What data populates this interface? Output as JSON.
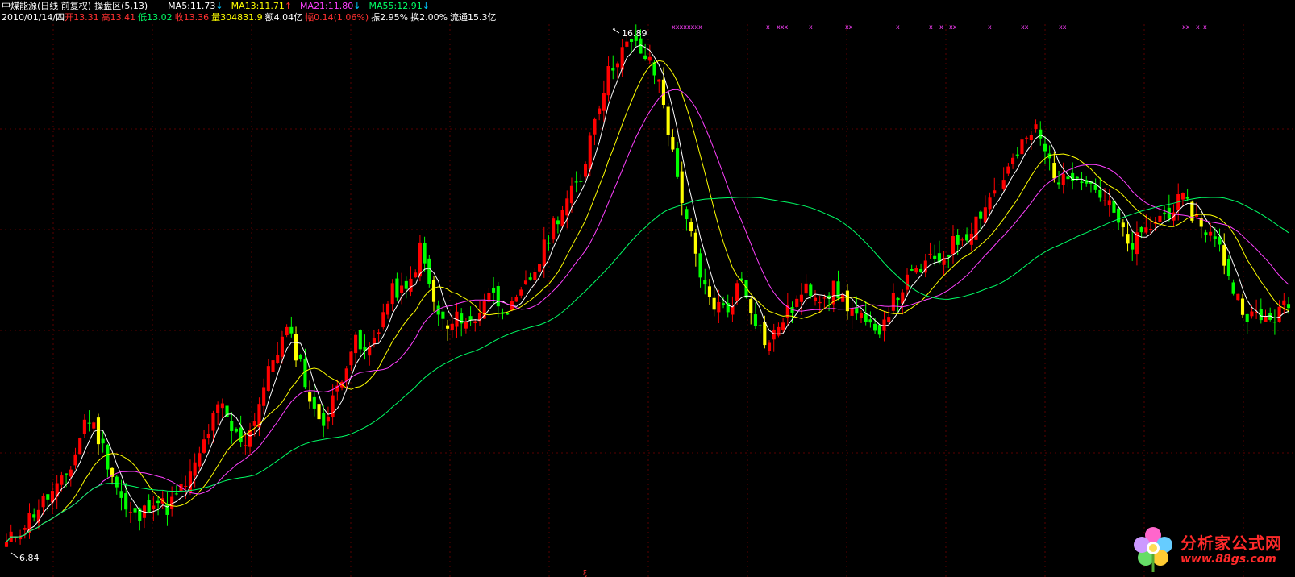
{
  "header": {
    "stock_title": "中煤能源(日线 前复权)",
    "panel_name": "操盘区",
    "params": "(5,13)",
    "ma_items": [
      {
        "label": "MA5:11.73",
        "arrow": "↓",
        "color": "#ffffff",
        "arrow_color": "#00c8ff"
      },
      {
        "label": "MA13:11.71",
        "arrow": "↑",
        "color": "#ffff00",
        "arrow_color": "#ff3030"
      },
      {
        "label": "MA21:11.80",
        "arrow": "↓",
        "color": "#ff40ff",
        "arrow_color": "#00c8ff"
      },
      {
        "label": "MA55:12.91",
        "arrow": "↓",
        "color": "#00ff66",
        "arrow_color": "#00c8ff"
      }
    ],
    "date": "2010/01/14/四",
    "quote": [
      {
        "label": "开",
        "value": "13.31",
        "label_color": "#ff3030",
        "value_color": "#ff3030"
      },
      {
        "label": "高",
        "value": "13.41",
        "label_color": "#ff3030",
        "value_color": "#ff3030"
      },
      {
        "label": "低",
        "value": "13.02",
        "label_color": "#00ff66",
        "value_color": "#00ff66"
      },
      {
        "label": "收",
        "value": "13.36",
        "label_color": "#ff3030",
        "value_color": "#ff3030"
      },
      {
        "label": "量",
        "value": "304831.9",
        "label_color": "#ffff00",
        "value_color": "#ffff00"
      },
      {
        "label": "额",
        "value": "4.04亿",
        "label_color": "#ffffff",
        "value_color": "#ffffff"
      },
      {
        "label": "幅",
        "value": "0.14(1.06%)",
        "label_color": "#ff3030",
        "value_color": "#ff3030"
      },
      {
        "label": "振",
        "value": "2.95%",
        "label_color": "#ffffff",
        "value_color": "#ffffff"
      },
      {
        "label": "换",
        "value": "2.00%",
        "label_color": "#ffffff",
        "value_color": "#ffffff"
      },
      {
        "label": "流通",
        "value": "15.3亿",
        "label_color": "#ffffff",
        "value_color": "#ffffff"
      }
    ]
  },
  "chart_labels": {
    "high_marker": "16.89",
    "low_marker": "6.84"
  },
  "watermark": {
    "name": "分析家公式网",
    "url": "www.88gs.com"
  },
  "colors": {
    "background": "#000000",
    "grid": "#5a0000",
    "up_candle": "#ff0000",
    "down_candle": "#00ff00",
    "special_candle": "#ffff00",
    "ma5": "#ffffff",
    "ma13": "#ffff00",
    "ma21": "#ff40ff",
    "ma55": "#00ff66",
    "signal": "#ff40ff"
  },
  "chart_data": {
    "type": "candlestick",
    "title": "中煤能源(日线 前复权)",
    "price_range": [
      6.84,
      16.89
    ],
    "series": [
      {
        "name": "MA5",
        "last": 11.73
      },
      {
        "name": "MA13",
        "last": 11.71
      },
      {
        "name": "MA21",
        "last": 11.8
      },
      {
        "name": "MA55",
        "last": 12.91
      }
    ],
    "close_trend": [
      7.0,
      7.3,
      7.6,
      7.9,
      8.1,
      8.6,
      9.5,
      9.0,
      8.3,
      7.6,
      7.5,
      7.9,
      7.7,
      8.0,
      8.4,
      9.1,
      9.7,
      9.1,
      9.0,
      9.8,
      10.6,
      11.1,
      10.5,
      9.5,
      9.4,
      10.2,
      10.9,
      10.6,
      11.3,
      11.9,
      11.8,
      12.7,
      11.6,
      11.1,
      11.4,
      11.2,
      11.9,
      11.6,
      11.5,
      12.0,
      12.5,
      13.2,
      13.6,
      14.0,
      15.2,
      16.0,
      16.5,
      16.6,
      16.3,
      15.8,
      14.3,
      13.2,
      12.0,
      11.6,
      11.5,
      12.1,
      11.4,
      10.8,
      11.3,
      11.6,
      11.9,
      11.8,
      11.9,
      11.6,
      11.3,
      11.0,
      11.5,
      11.9,
      12.2,
      12.4,
      12.5,
      12.8,
      13.0,
      13.4,
      13.8,
      14.2,
      14.6,
      15.0,
      14.4,
      13.9,
      14.2,
      14.0,
      13.7,
      13.3,
      12.7,
      12.9,
      13.2,
      13.4,
      13.6,
      13.3,
      13.0,
      12.6,
      11.8,
      11.4,
      11.3,
      11.4,
      11.6
    ],
    "signal_marks": [
      "xxxxxxxx",
      "x",
      "xxx",
      "x",
      "xx",
      "x",
      "x",
      "x",
      "xx",
      "x",
      "xx",
      "xx",
      "xx",
      "x",
      "x"
    ]
  }
}
